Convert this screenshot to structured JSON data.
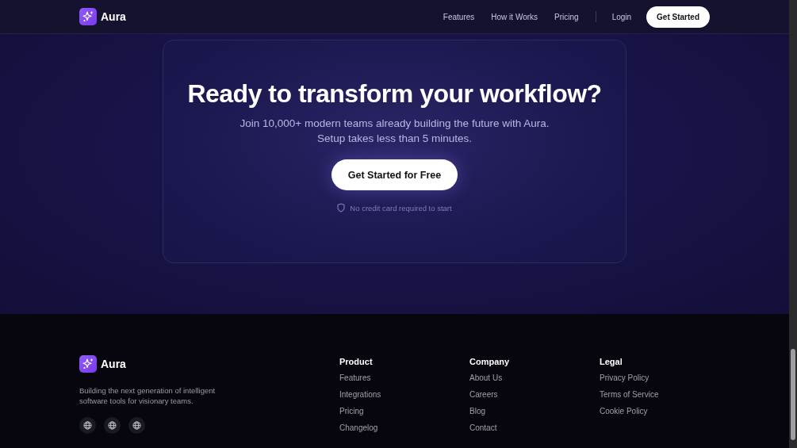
{
  "nav": {
    "brand": "Aura",
    "links": [
      "Features",
      "How it Works",
      "Pricing"
    ],
    "login": "Login",
    "cta": "Get Started"
  },
  "cta": {
    "title": "Ready to transform your workflow?",
    "subtitle": [
      "Join 10,000+ modern teams already building the future with Aura.",
      "Setup takes less than 5 minutes."
    ],
    "button": "Get Started for Free",
    "note": "No credit card required to start"
  },
  "footer": {
    "brand": "Aura",
    "tagline": "Building the next generation of intelligent software tools for visionary teams.",
    "social_links": [
      {
        "kind": "globe"
      },
      {
        "kind": "globe"
      },
      {
        "kind": "globe"
      }
    ],
    "columns": [
      {
        "title": "Product",
        "links": [
          "Features",
          "Integrations",
          "Pricing",
          "Changelog"
        ]
      },
      {
        "title": "Company",
        "links": [
          "About Us",
          "Careers",
          "Blog",
          "Contact"
        ]
      },
      {
        "title": "Legal",
        "links": [
          "Privacy Policy",
          "Terms of Service",
          "Cookie Policy"
        ]
      }
    ]
  }
}
